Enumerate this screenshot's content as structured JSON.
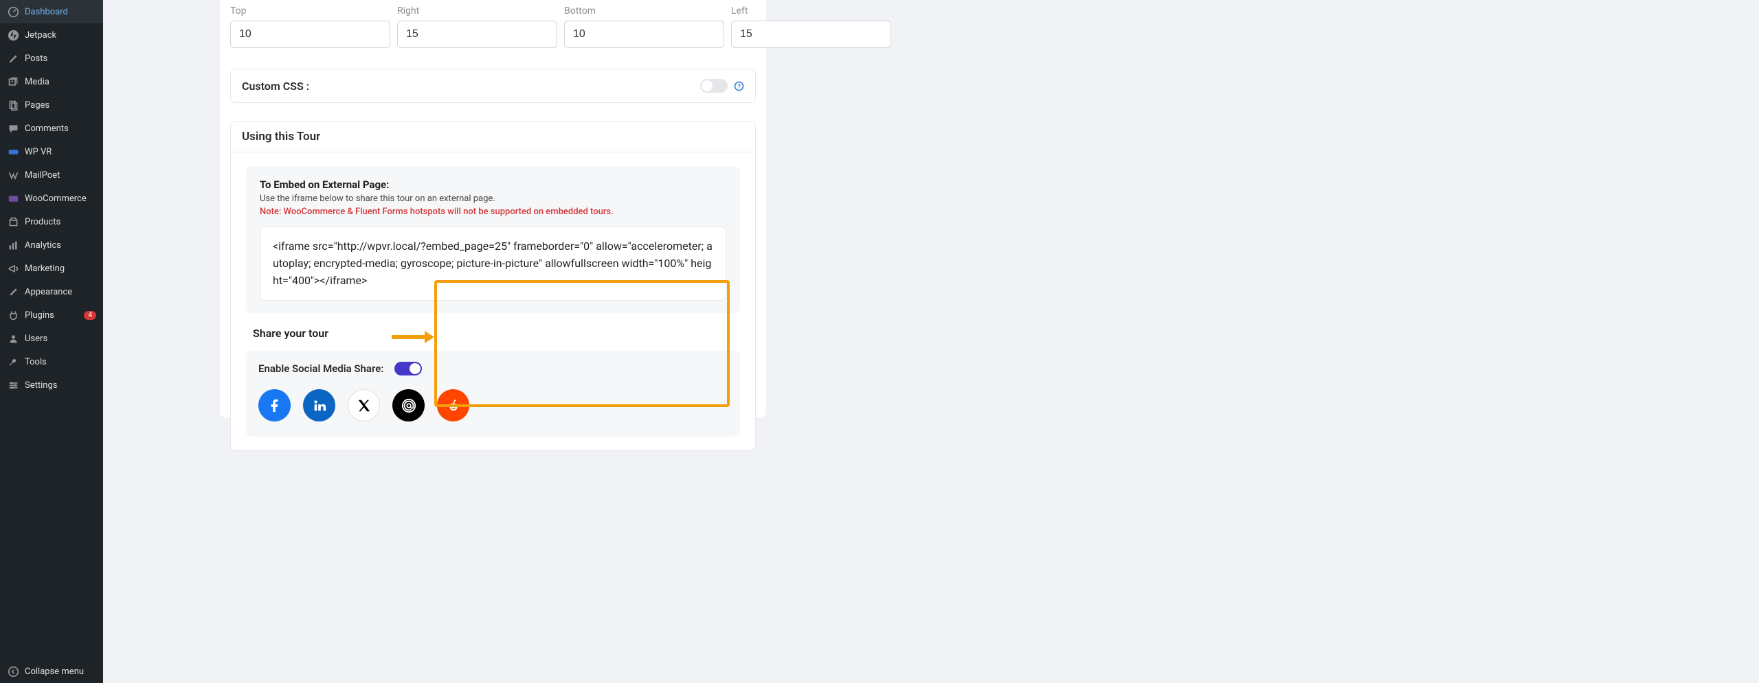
{
  "sidebar": {
    "items": [
      {
        "label": "Dashboard"
      },
      {
        "label": "Jetpack"
      },
      {
        "label": "Posts"
      },
      {
        "label": "Media"
      },
      {
        "label": "Pages"
      },
      {
        "label": "Comments"
      },
      {
        "label": "WP VR"
      },
      {
        "label": "MailPoet"
      },
      {
        "label": "WooCommerce"
      },
      {
        "label": "Products"
      },
      {
        "label": "Analytics"
      },
      {
        "label": "Marketing"
      },
      {
        "label": "Appearance"
      },
      {
        "label": "Plugins",
        "badge": "4"
      },
      {
        "label": "Users"
      },
      {
        "label": "Tools"
      },
      {
        "label": "Settings"
      }
    ],
    "collapse": "Collapse menu"
  },
  "padding": {
    "top_label": "Top",
    "top": "10",
    "right_label": "Right",
    "right": "15",
    "bottom_label": "Bottom",
    "bottom": "10",
    "left_label": "Left",
    "left": "15"
  },
  "custom_css_label": "Custom CSS :",
  "tour": {
    "header": "Using this Tour",
    "embed_title": "To Embed on External Page:",
    "embed_sub": "Use the iframe below to share this tour on an external page.",
    "embed_note": "Note: WooCommerce & Fluent Forms hotspots will not be supported on embedded tours.",
    "code": "<iframe src=\"http://wpvr.local/?embed_page=25\" frameborder=\"0\" allow=\"accelerometer; autoplay; encrypted-media; gyroscope; picture-in-picture\" allowfullscreen width=\"100%\" height=\"400\"></iframe>"
  },
  "share": {
    "title": "Share your tour",
    "label": "Enable Social Media Share:"
  }
}
